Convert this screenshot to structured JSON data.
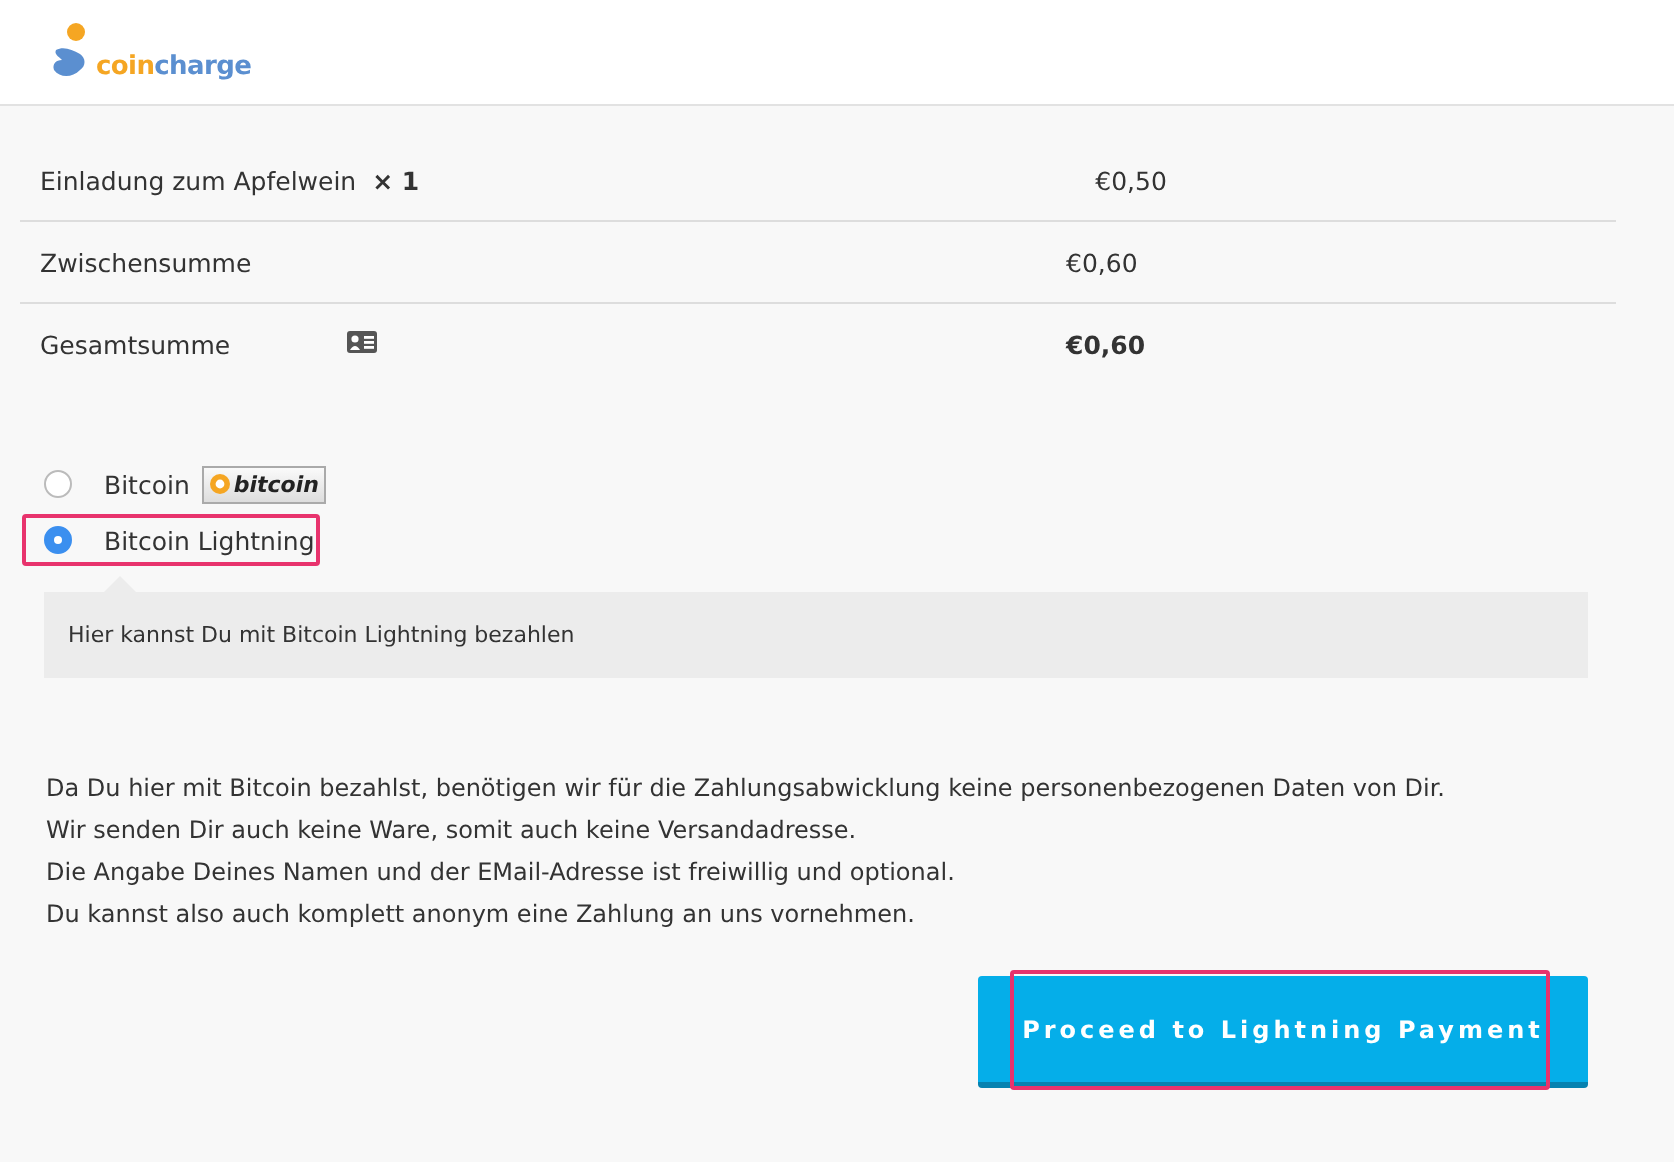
{
  "header": {
    "logo": {
      "coin": "coin",
      "charge": "charge"
    }
  },
  "order": {
    "rows": [
      {
        "kind": "item",
        "label": "Einladung zum Apfelwein",
        "quantity": "× 1",
        "amount": "€0,50"
      },
      {
        "kind": "subtotal",
        "label": "Zwischensumme",
        "amount": "€0,60"
      },
      {
        "kind": "total",
        "label": "Gesamtsumme",
        "amount": "€0,60"
      }
    ]
  },
  "payment_methods": [
    {
      "label": "Bitcoin",
      "selected": false,
      "badge": "bitcoin"
    },
    {
      "label": "Bitcoin Lightning",
      "selected": true,
      "highlighted": true,
      "description": "Hier kannst Du mit Bitcoin Lightning bezahlen"
    }
  ],
  "notice": [
    "Da Du hier mit Bitcoin bezahlst, benötigen wir für die Zahlungsabwicklung keine personenbezogenen Daten von Dir.",
    "Wir senden Dir auch keine Ware, somit auch keine Versandadresse.",
    "Die Angabe Deines Namen und der EMail-Adresse ist freiwillig und optional.",
    "Du kannst also auch komplett anonym eine Zahlung an uns vornehmen."
  ],
  "submit": {
    "label": "Proceed to Lightning Payment",
    "highlighted": true
  }
}
